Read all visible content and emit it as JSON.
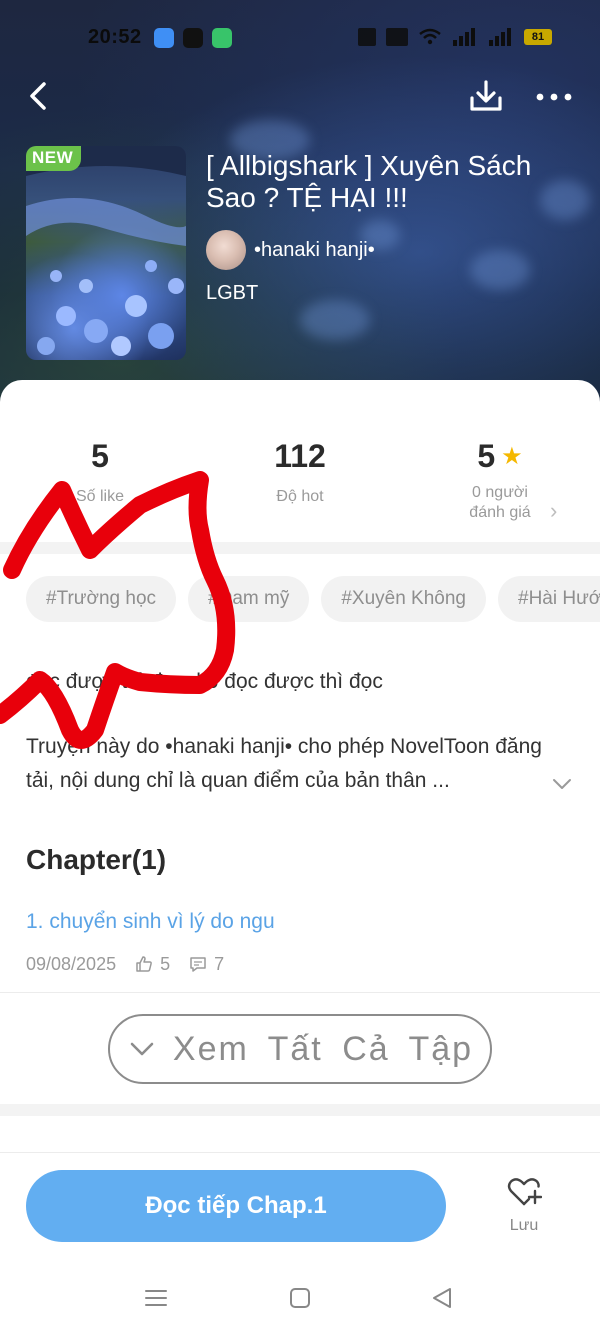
{
  "status_bar": {
    "time": "20:52",
    "battery": "81",
    "icons": [
      "messages-icon",
      "zalo-icon",
      "chat-icon",
      "nfc-icon",
      "sim-icon",
      "wifi-icon",
      "signal-icon",
      "battery-icon"
    ]
  },
  "header": {
    "back_icon": "back-arrow-icon",
    "download_icon": "download-icon",
    "more_icon": "more-icon"
  },
  "book": {
    "badge": "NEW",
    "title": "[ Allbigshark ] Xuyên Sách Sao ? TỆ HẠI !!!",
    "author": "•hanaki hanji•",
    "genre": "LGBT"
  },
  "stats": [
    {
      "value": "5",
      "label": "Số like"
    },
    {
      "value": "112",
      "label": "Độ hot"
    },
    {
      "value": "5",
      "label": "0 người\nđánh giá",
      "icon": "star-icon"
    }
  ],
  "tags": [
    "#Trường học",
    "#Đam mỹ",
    "#Xuyên Không",
    "#Hài Hước"
  ],
  "summary": "đọc được thì đọc, ko đọc được thì đọc",
  "disclaimer": "Truyện này do •hanaki hanji• cho phép NovelToon đăng tải, nội dung chỉ là quan điểm của bản thân ...",
  "chapters": {
    "heading": "Chapter(1)",
    "items": [
      {
        "title": "1. chuyển sinh vì lý do ngu",
        "date": "09/08/2025",
        "likes": "5",
        "comments": "7"
      }
    ],
    "see_all": "Xem Tất Cả Tập"
  },
  "bottom": {
    "read_button": "Đọc tiếp Chap.1",
    "save_label": "Lưu"
  },
  "colors": {
    "accent": "#62aef1",
    "chapter_link": "#5aa3e6",
    "star": "#f5b800",
    "new_badge": "#6cc24a",
    "scribble": "#e8000b"
  }
}
